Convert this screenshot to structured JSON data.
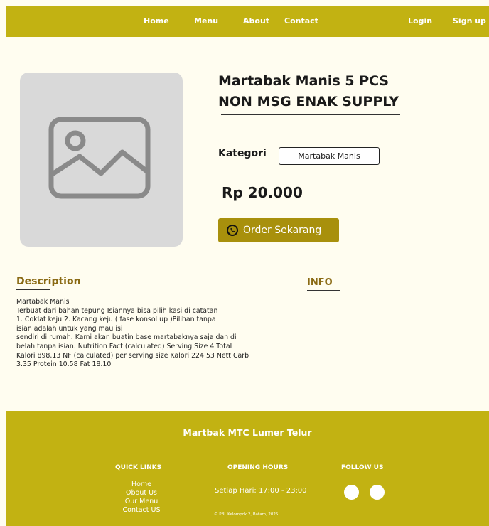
{
  "nav": {
    "home": "Home",
    "menu": "Menu",
    "about": "About",
    "contact": "Contact",
    "login": "Login",
    "signup": "Sign up"
  },
  "product": {
    "title_line1": "Martabak Manis 5 PCS",
    "title_line2": "NON MSG ENAK SUPPLY",
    "kategori_label": "Kategori",
    "kategori_value": "Martabak Manis",
    "price": "Rp 20.000",
    "order_label": "Order Sekarang",
    "image_icon": "image-placeholder-icon"
  },
  "description": {
    "heading": "Description",
    "lines": [
      "Martabak Manis",
      "Terbuat dari bahan tepung Isiannya bisa pilih kasi di catatan",
      "1. Coklat keju 2. Kacang keju ( fase konsol up )Pilihan tanpa",
      "isian adalah untuk yang mau isi",
      "sendiri di rumah. Kami akan buatin base martabaknya saja dan di",
      "belah tanpa isian. Nutrition Fact (calculated) Serving Size 4 Total",
      "Kalori 898.13 NF (calculated) per serving size Kalori 224.53 Nett Carb",
      "3.35 Protein 10.58 Fat 18.10"
    ]
  },
  "info": {
    "heading": "INFO"
  },
  "footer": {
    "brand": "Martbak MTC Lumer Telur",
    "quick_links_heading": "QUICK LINKS",
    "quick_links": [
      "Home",
      "Obout Us",
      "Our Menu",
      "Contact US"
    ],
    "opening_hours_heading": "OPENING HOURS",
    "opening_hours": "Setiap Hari: 17:00 - 23:00",
    "follow_us_heading": "FOLLOW US",
    "copyright": "©  PBL Kelompok 2, Batam, 2025"
  },
  "colors": {
    "brand": "#c2b212",
    "button": "#a8900c",
    "background": "#fffdf0",
    "heading_accent": "#8a6a14"
  }
}
